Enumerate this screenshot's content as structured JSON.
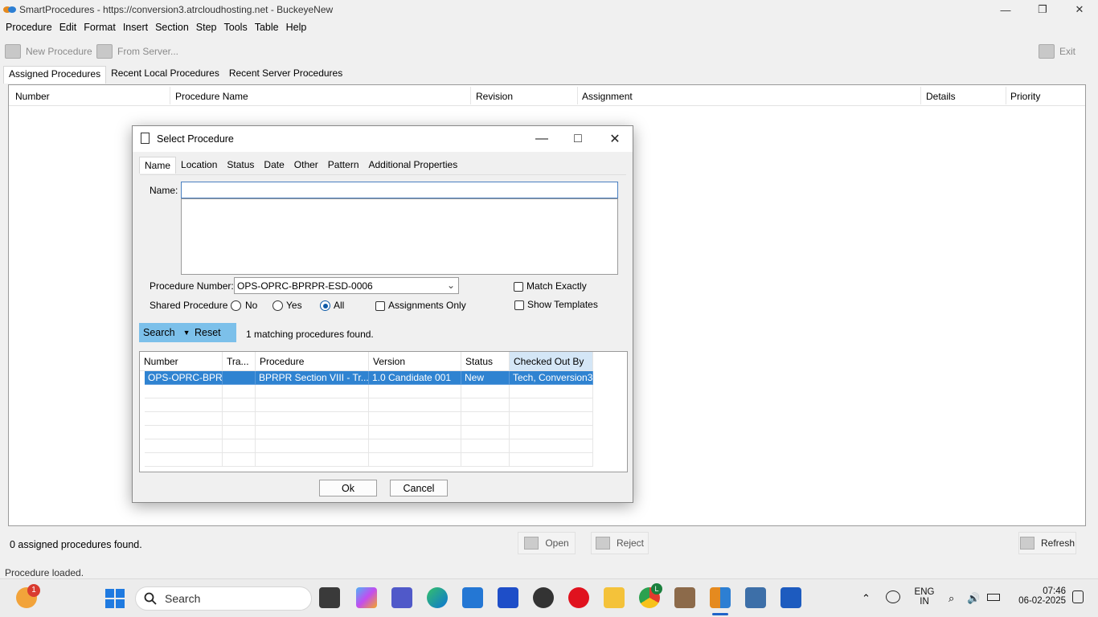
{
  "window": {
    "title": "SmartProcedures - https://conversion3.atrcloudhosting.net - BuckeyeNew"
  },
  "menu": [
    "Procedure",
    "Edit",
    "Format",
    "Insert",
    "Section",
    "Step",
    "Tools",
    "Table",
    "Help"
  ],
  "toolbar": {
    "new_procedure": "New Procedure",
    "from_server": "From Server...",
    "exit": "Exit"
  },
  "main_tabs": [
    "Assigned Procedures",
    "Recent Local Procedures",
    "Recent Server Procedures"
  ],
  "main_columns": [
    "Number",
    "Procedure Name",
    "Revision",
    "Assignment",
    "Details",
    "Priority"
  ],
  "main_footer": {
    "count_text": "0 assigned procedures found.",
    "open": "Open",
    "reject": "Reject",
    "refresh": "Refresh",
    "status": "Procedure loaded."
  },
  "dialog": {
    "title": "Select Procedure",
    "tabs": [
      "Name",
      "Location",
      "Status",
      "Date",
      "Other",
      "Pattern",
      "Additional Properties"
    ],
    "name_label": "Name:",
    "name_value": "",
    "procedure_number_label": "Procedure Number:",
    "procedure_number_value": "OPS-OPRC-BPRPR-ESD-0006",
    "shared_label": "Shared Procedure :",
    "shared_options": [
      "No",
      "Yes",
      "All"
    ],
    "shared_selected": "All",
    "assignments_only": "Assignments Only",
    "match_exactly": "Match Exactly",
    "show_templates": "Show Templates",
    "search": "Search",
    "reset": "Reset",
    "result_text": "1 matching procedures found.",
    "columns": [
      "Number",
      "Tra...",
      "Procedure",
      "Version",
      "Status",
      "Checked Out By"
    ],
    "rows": [
      [
        "OPS-OPRC-BPR...",
        "",
        "BPRPR Section VIII - Tr...",
        "1.0 Candidate 001",
        "New",
        "Tech, Conversion3"
      ]
    ],
    "ok": "Ok",
    "cancel": "Cancel"
  },
  "taskbar": {
    "search": "Search",
    "badge": "1",
    "chrome_badge": "L",
    "lang_top": "ENG",
    "lang_bottom": "IN",
    "time": "07:46",
    "date": "06-02-2025"
  }
}
